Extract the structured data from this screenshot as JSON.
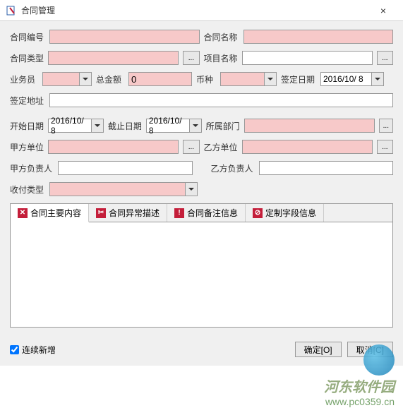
{
  "window": {
    "title": "合同管理",
    "close": "×"
  },
  "labels": {
    "contract_no": "合同编号",
    "contract_name": "合同名称",
    "contract_type": "合同类型",
    "project_name": "项目名称",
    "salesman": "业务员",
    "total_amount": "总金额",
    "currency": "币种",
    "sign_date": "签定日期",
    "sign_address": "签定地址",
    "start_date": "开始日期",
    "end_date": "截止日期",
    "department": "所属部门",
    "party_a": "甲方单位",
    "party_b": "乙方单位",
    "party_a_lead": "甲方负责人",
    "party_b_lead": "乙方负责人",
    "pay_type": "收付类型"
  },
  "values": {
    "contract_no": "",
    "contract_name": "",
    "contract_type": "",
    "project_name": "",
    "salesman": "",
    "total_amount": "0",
    "currency": "",
    "sign_date": "2016/10/ 8",
    "sign_address": "",
    "start_date": "2016/10/ 8",
    "end_date": "2016/10/ 8",
    "department": "",
    "party_a": "",
    "party_b": "",
    "party_a_lead": "",
    "party_b_lead": "",
    "pay_type": ""
  },
  "dots": "...",
  "tabs": {
    "t1": "合同主要内容",
    "t2": "合同异常描述",
    "t3": "合同备注信息",
    "t4": "定制字段信息"
  },
  "footer": {
    "continue_add": "连续新增",
    "ok": "确定[O]",
    "cancel": "取消[C]"
  },
  "watermark": {
    "text": "河东软件园",
    "url": "www.pc0359.cn"
  }
}
